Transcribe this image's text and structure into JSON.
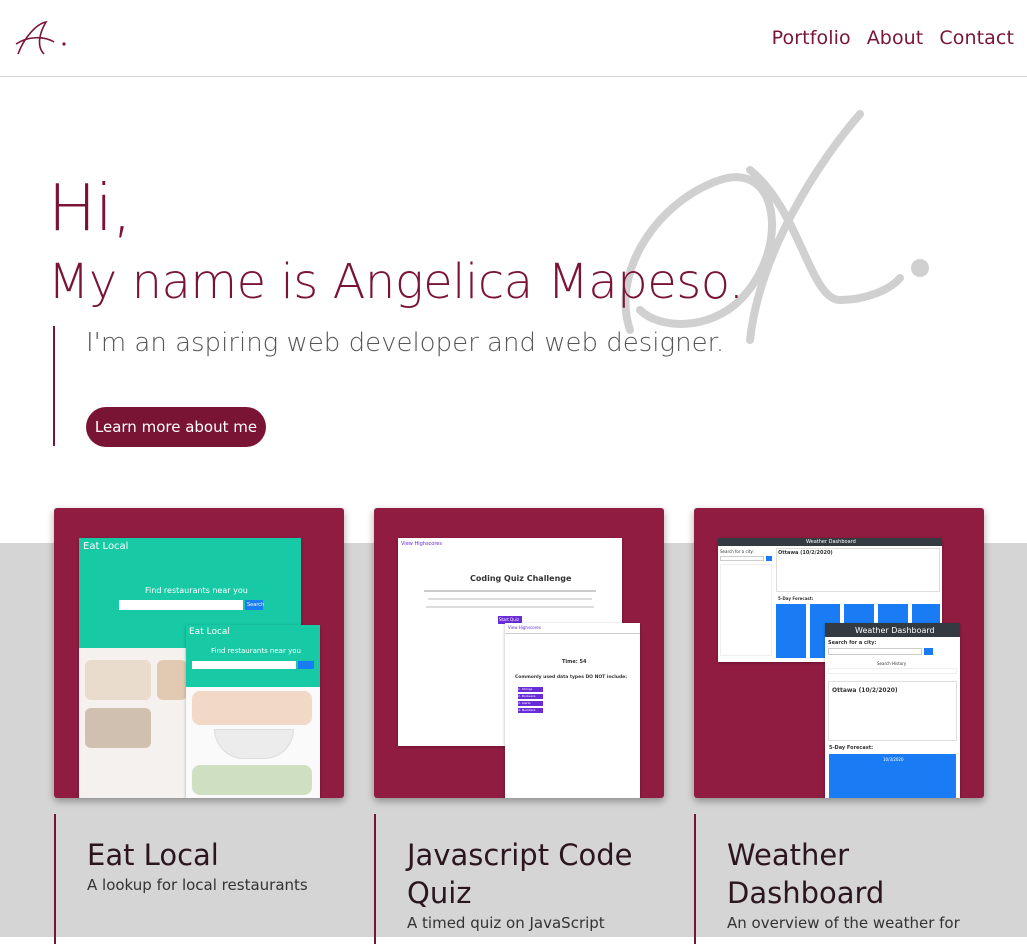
{
  "nav": {
    "logo": "logo-icon",
    "links": [
      "Portfolio",
      "About",
      "Contact"
    ]
  },
  "hero": {
    "greeting": "Hi,",
    "name_line": "My name is Angelica Mapeso.",
    "tagline": "I'm an aspiring web developer and web designer.",
    "button_label": "Learn more about me"
  },
  "projects": [
    {
      "title": "Eat Local",
      "description": "A lookup for local restaurants",
      "shot_header": "Eat Local",
      "shot_heading": "Find restaurants near you",
      "shot_button": "Search"
    },
    {
      "title": "Javascript Code Quiz",
      "description": "A timed quiz on JavaScript",
      "shot_heading": "Coding Quiz Challenge",
      "shot_link": "View Highscores",
      "shot_start": "Start Quiz",
      "shot_timer": "Time: 54",
      "shot_question": "Commonly used data types DO NOT include:",
      "shot_answers": [
        "1. Strings",
        "2. Booleans",
        "3. Alerts",
        "4. Numbers"
      ]
    },
    {
      "title": "Weather Dashboard",
      "description": "An overview of the weather for",
      "shot_header": "Weather Dashboard",
      "shot_search": "Search for a city:",
      "shot_city": "Ottawa (10/2/2020)",
      "shot_history": "Search History",
      "shot_forecast": "5-Day Forecast:",
      "shot_date": "10/3/2020",
      "shot_small_city": "Ottawa (10/2/2020)"
    }
  ],
  "colors": {
    "brand": "#7a1435",
    "card": "#911c42",
    "teal": "#17c9a5",
    "blue": "#1a7cf5"
  }
}
